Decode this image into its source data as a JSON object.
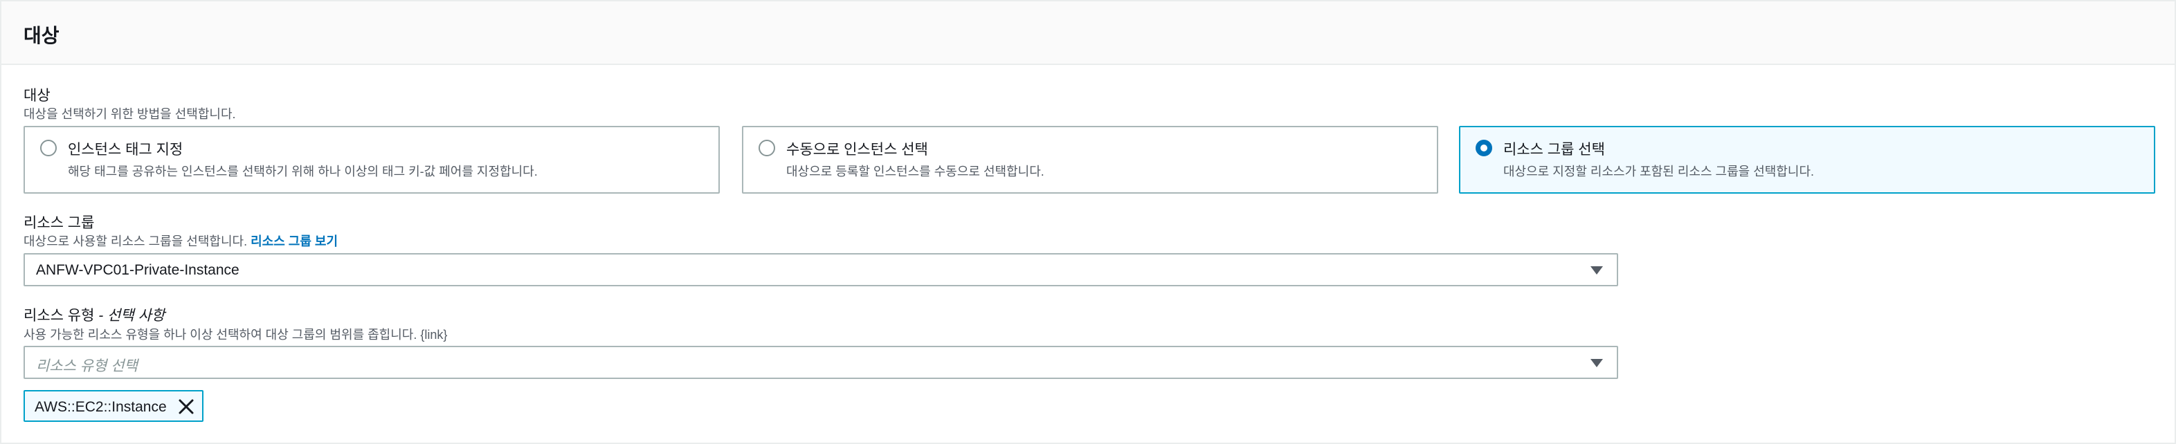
{
  "panel": {
    "title": "대상"
  },
  "target": {
    "label": "대상",
    "description": "대상을 선택하기 위한 방법을 선택합니다.",
    "options": [
      {
        "title": "인스턴스 태그 지정",
        "description": "해당 태그를 공유하는 인스턴스를 선택하기 위해 하나 이상의 태그 키-값 페어를 지정합니다.",
        "selected": false
      },
      {
        "title": "수동으로 인스턴스 선택",
        "description": "대상으로 등록할 인스턴스를 수동으로 선택합니다.",
        "selected": false
      },
      {
        "title": "리소스 그룹 선택",
        "description": "대상으로 지정할 리소스가 포함된 리소스 그룹을 선택합니다.",
        "selected": true
      }
    ]
  },
  "resource_group": {
    "label": "리소스 그룹",
    "description": "대상으로 사용할 리소스 그룹을 선택합니다.",
    "link": "리소스 그룹 보기",
    "value": "ANFW-VPC01-Private-Instance"
  },
  "resource_type": {
    "label": "리소스 유형",
    "label_optional": "- 선택 사항",
    "description": "사용 가능한 리소스 유형을 하나 이상 선택하여 대상 그룹의 범위를 좁힙니다. {link}",
    "placeholder": "리소스 유형 선택",
    "tokens": [
      "AWS::EC2::Instance"
    ]
  },
  "icons": {
    "radio": "radio-icon",
    "caret": "caret-down-icon",
    "dismiss": "close-icon"
  },
  "colors": {
    "accent": "#0073bb",
    "selected_border": "#00a1c9",
    "selected_bg": "#f1faff"
  }
}
